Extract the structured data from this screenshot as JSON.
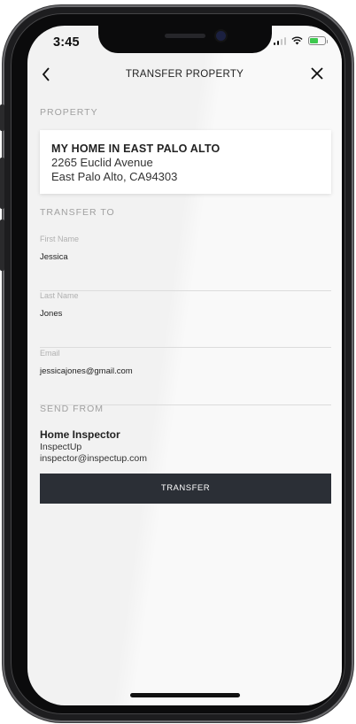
{
  "status_bar": {
    "time": "3:45"
  },
  "nav": {
    "title": "TRANSFER PROPERTY",
    "back_icon": "chevron-left-icon",
    "close_icon": "close-icon"
  },
  "property": {
    "section_label": "PROPERTY",
    "name": "MY HOME IN EAST PALO ALTO",
    "address_line1": "2265 Euclid Avenue",
    "address_line2": "East Palo Alto, CA94303"
  },
  "transfer_to": {
    "section_label": "TRANSFER TO",
    "fields": [
      {
        "label": "First Name",
        "value": "Jessica"
      },
      {
        "label": "Last Name",
        "value": "Jones"
      },
      {
        "label": "Email",
        "value": "jessicajones@gmail.com"
      }
    ]
  },
  "send_from": {
    "section_label": "SEND FROM",
    "name": "Home Inspector",
    "company": "InspectUp",
    "email": "inspector@inspectup.com"
  },
  "actions": {
    "transfer_label": "TRANSFER"
  },
  "colors": {
    "button_bg": "#2b2f36",
    "screen_bg": "#f2f2f2",
    "battery": "#3dc84e"
  }
}
